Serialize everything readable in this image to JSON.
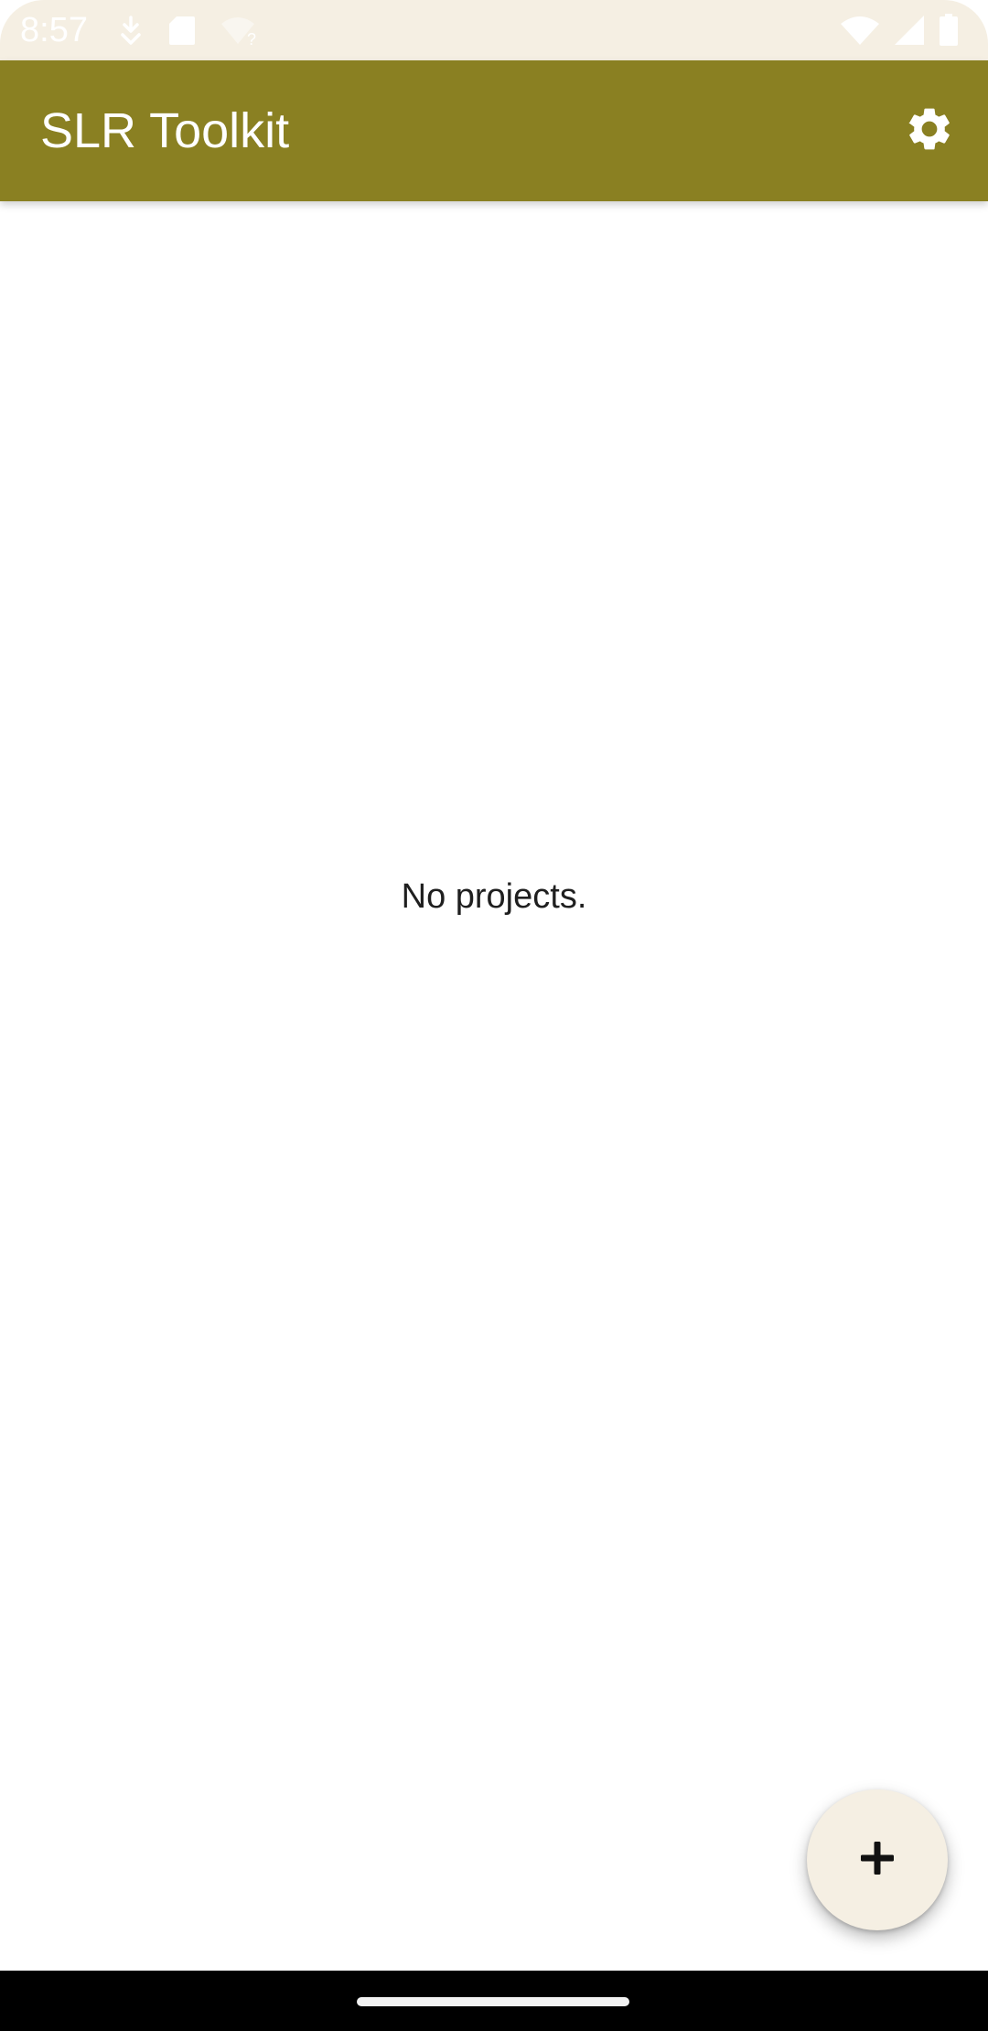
{
  "status_bar": {
    "time": "8:57",
    "left_icons": [
      "download-icon",
      "sd-card-icon",
      "wifi-unknown-icon"
    ],
    "right_icons": [
      "wifi-icon",
      "signal-icon",
      "battery-icon"
    ]
  },
  "app_bar": {
    "title": "SLR Toolkit",
    "actions": [
      "gear-icon"
    ],
    "color": "#8a8022"
  },
  "main": {
    "empty_message": "No projects."
  },
  "fab": {
    "icon": "plus-icon",
    "color": "#f5efe3"
  },
  "colors": {
    "status_bar_bg": "#f5efe3",
    "app_bar_bg": "#8a8022",
    "page_bg": "#ffffff",
    "nav_bar_bg": "#000000"
  }
}
